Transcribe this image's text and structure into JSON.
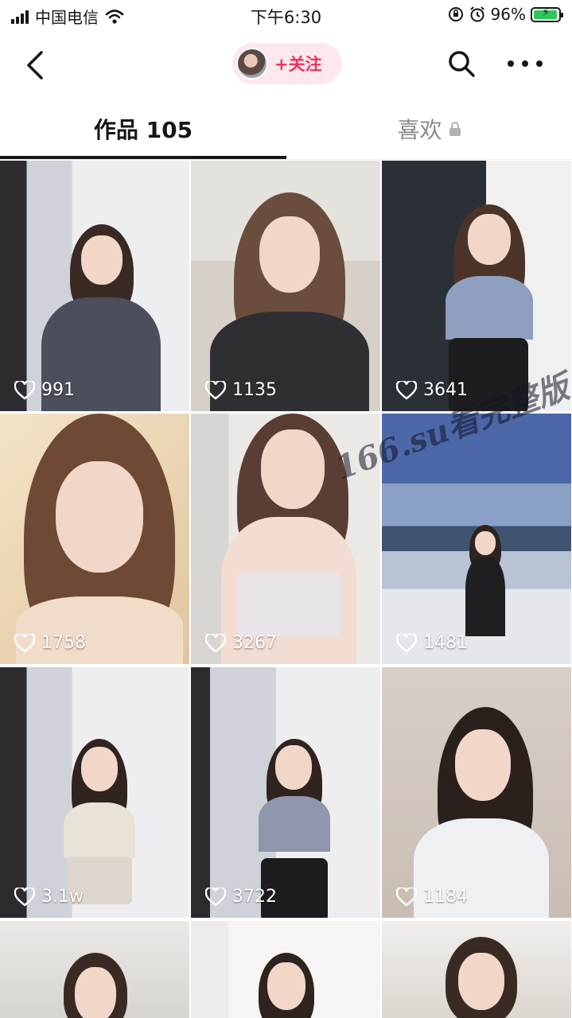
{
  "status_bar": {
    "carrier": "中国电信",
    "time": "下午6:30",
    "battery_percent": "96%"
  },
  "nav": {
    "follow_label": "+关注"
  },
  "tabs": {
    "works": "作品 105",
    "likes": "喜欢"
  },
  "videos": [
    {
      "likes": "991"
    },
    {
      "likes": "1135"
    },
    {
      "likes": "3641"
    },
    {
      "likes": "1758"
    },
    {
      "likes": "3267"
    },
    {
      "likes": "1481"
    },
    {
      "likes": "3.1w"
    },
    {
      "likes": "3722"
    },
    {
      "likes": "1184"
    },
    {
      "likes": ""
    },
    {
      "likes": ""
    },
    {
      "likes": ""
    }
  ],
  "watermark": "166.su看完整版",
  "colors": {
    "accent": "#f0315b",
    "follow_bg": "#fde8ee",
    "battery": "#2fc65a"
  }
}
